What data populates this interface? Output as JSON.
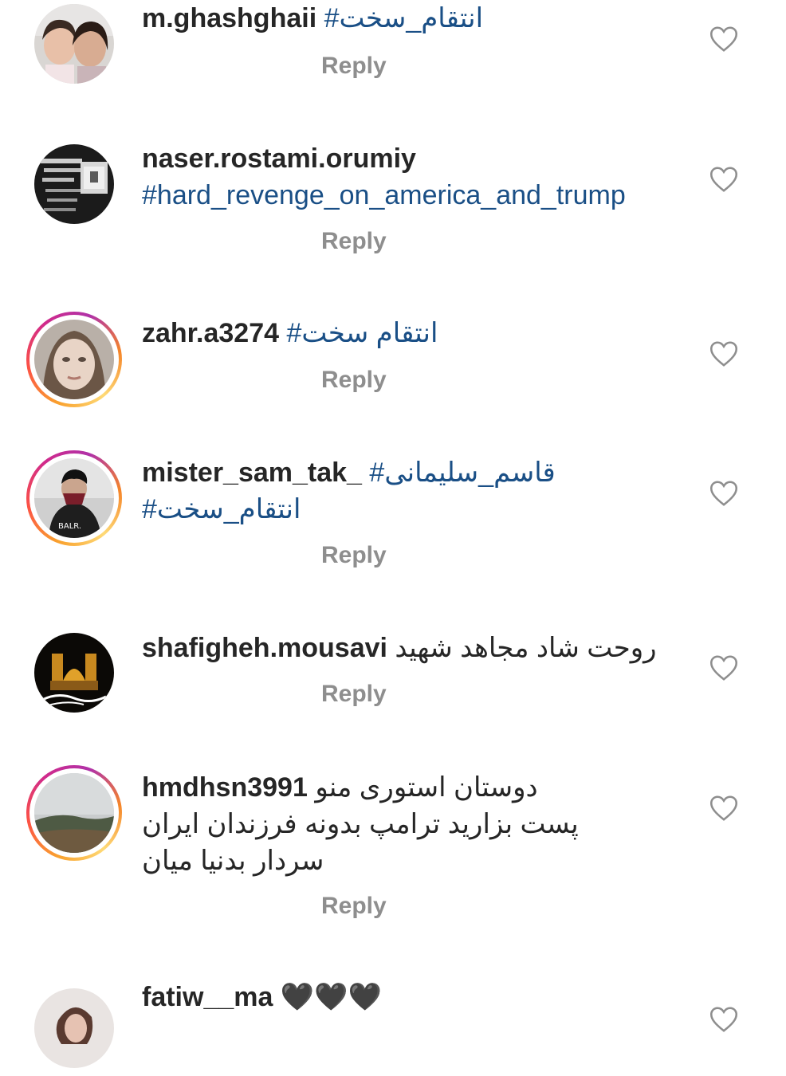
{
  "ui": {
    "reply_label": "Reply",
    "heart_icon": "heart-outline-icon",
    "hashtag_color": "#1a4f86",
    "reply_color": "#8e8e8e",
    "story_ring_colors": [
      "#f9a12e",
      "#fc5245",
      "#d12a8b",
      "#b032a8"
    ]
  },
  "comments": [
    {
      "username": "m.ghashghaii",
      "line1": "#انتقام_سخت",
      "line2": "",
      "line3": "",
      "story_ring": false
    },
    {
      "username": "naser.rostami.orumiy",
      "line1": "",
      "line2": "#hard_revenge_on_america_and_trump",
      "line3": "",
      "story_ring": false
    },
    {
      "username": "zahr.a3274",
      "line1": "#انتقام سخت",
      "line2": "",
      "line3": "",
      "story_ring": true
    },
    {
      "username": "mister_sam_tak_",
      "line1": "#قاسم_سلیمانی",
      "line2": "#انتقام_سخت",
      "line3": "",
      "story_ring": true
    },
    {
      "username": "shafigheh.mousavi",
      "line1": "روحت شاد مجاهد شهید",
      "line2": "",
      "line3": "",
      "story_ring": false
    },
    {
      "username": "hmdhsn3991",
      "line1": "دوستان استوری منو",
      "line2": "پست بزارید ترامپ بدونه فرزندان ایران",
      "line3": "سردار بدنیا میان",
      "story_ring": true
    },
    {
      "username": "fatiw__ma",
      "line1": "🖤🖤🖤",
      "line2": "",
      "line3": "",
      "story_ring": false
    }
  ],
  "avatar_texts": {
    "avatar_4_shirt": "BALR."
  }
}
